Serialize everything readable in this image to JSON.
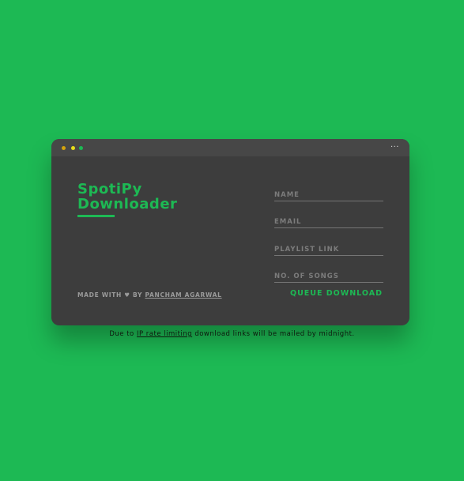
{
  "colors": {
    "background": "#1db954",
    "accent": "#1db954",
    "window": "#3d3d3d",
    "titlebar": "#474747",
    "dot_1": "#d4a30d",
    "dot_2": "#e8dc1a",
    "dot_3": "#1db954"
  },
  "titlebar": {
    "menu_icon": "more-horizontal-icon",
    "menu_glyph": "···"
  },
  "app": {
    "title_line1": "SpotiPy",
    "title_line2": "Downloader"
  },
  "credit": {
    "prefix": "MADE WITH ♥ BY ",
    "author": "PANCHAM AGARWAL"
  },
  "form": {
    "name_placeholder": "NAME",
    "email_placeholder": "EMAIL",
    "playlist_placeholder": "PLAYLIST LINK",
    "songs_placeholder": "NO. OF SONGS",
    "submit_label": "QUEUE DOWNLOAD"
  },
  "note": {
    "prefix": "Due to ",
    "link": "IP rate limiting",
    "suffix": " download links will be mailed by midnight."
  }
}
